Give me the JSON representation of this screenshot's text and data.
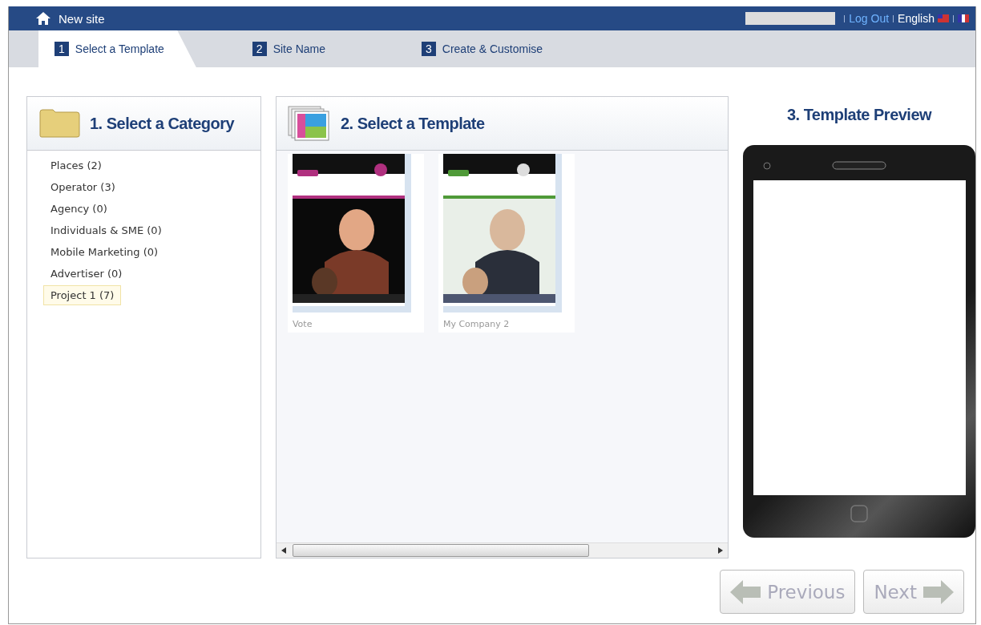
{
  "top_bar": {
    "title": "New site",
    "links": [
      {
        "kind": "link",
        "label": "Log Out"
      },
      {
        "kind": "language",
        "label": "English"
      }
    ]
  },
  "steps": [
    {
      "number": "1",
      "label": "Select a Template",
      "selected": true
    },
    {
      "number": "2",
      "label": "Site Name",
      "selected": false
    },
    {
      "number": "3",
      "label": "Create & Customise",
      "selected": false
    }
  ],
  "category_panel": {
    "title": "1. Select a Category",
    "items": [
      {
        "label": "Places (2)",
        "selected": false
      },
      {
        "label": "Operator (3)",
        "selected": false
      },
      {
        "label": "Agency (0)",
        "selected": false
      },
      {
        "label": "Individuals & SME (0)",
        "selected": false
      },
      {
        "label": "Mobile Marketing (0)",
        "selected": false
      },
      {
        "label": "Advertiser (0)",
        "selected": false
      },
      {
        "label": "Project 1 (7)",
        "selected": true
      }
    ]
  },
  "template_panel": {
    "title": "2. Select a Template",
    "templates": [
      {
        "name": "Vote",
        "kind": "picture",
        "selected": false
      },
      {
        "name": "My Company 2",
        "kind": "picture",
        "selected": false
      }
    ]
  },
  "preview_panel": {
    "title": "3. Template Preview"
  },
  "buttons": [
    {
      "kind": "previous",
      "label": "Previous",
      "disabled": true
    },
    {
      "kind": "next",
      "label": "Next",
      "disabled": true
    }
  ]
}
